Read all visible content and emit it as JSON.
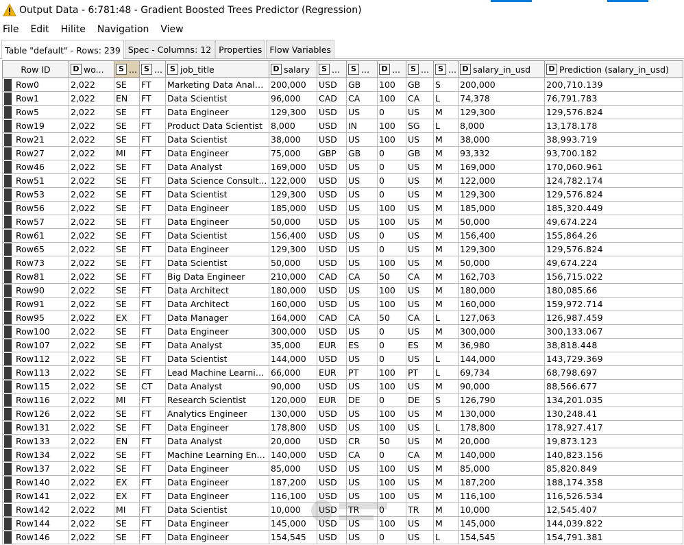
{
  "window": {
    "title": "Output Data - 6:781:48 - Gradient Boosted Trees Predictor (Regression)"
  },
  "menu": [
    "File",
    "Edit",
    "Hilite",
    "Navigation",
    "View"
  ],
  "tabs": [
    "Table \"default\" - Rows: 239",
    "Spec - Columns: 12",
    "Properties",
    "Flow Variables"
  ],
  "columns": [
    {
      "type": "",
      "label": "Row ID"
    },
    {
      "type": "D",
      "label": "wo..."
    },
    {
      "type": "S",
      "label": "..."
    },
    {
      "type": "S",
      "label": "..."
    },
    {
      "type": "S",
      "label": "job_title"
    },
    {
      "type": "D",
      "label": "salary"
    },
    {
      "type": "S",
      "label": "..."
    },
    {
      "type": "S",
      "label": "..."
    },
    {
      "type": "D",
      "label": "..."
    },
    {
      "type": "S",
      "label": "..."
    },
    {
      "type": "S",
      "label": "..."
    },
    {
      "type": "D",
      "label": "salary_in_usd"
    },
    {
      "type": "D",
      "label": "Prediction (salary_in_usd)"
    }
  ],
  "rows": [
    [
      "Row0",
      "2,022",
      "SE",
      "FT",
      "Marketing Data Analyst",
      "200,000",
      "USD",
      "GB",
      "100",
      "GB",
      "S",
      "200,000",
      "200,710.139"
    ],
    [
      "Row1",
      "2,022",
      "EN",
      "FT",
      "Data Scientist",
      "96,000",
      "CAD",
      "CA",
      "100",
      "CA",
      "L",
      "74,378",
      "76,791.783"
    ],
    [
      "Row5",
      "2,022",
      "SE",
      "FT",
      "Data Engineer",
      "129,300",
      "USD",
      "US",
      "0",
      "US",
      "M",
      "129,300",
      "129,576.824"
    ],
    [
      "Row19",
      "2,022",
      "SE",
      "FT",
      "Product Data Scientist",
      "8,000",
      "USD",
      "IN",
      "100",
      "SG",
      "L",
      "8,000",
      "13,178.178"
    ],
    [
      "Row21",
      "2,022",
      "SE",
      "FT",
      "Data Scientist",
      "38,000",
      "USD",
      "US",
      "100",
      "US",
      "M",
      "38,000",
      "38,993.719"
    ],
    [
      "Row27",
      "2,022",
      "MI",
      "FT",
      "Data Engineer",
      "75,000",
      "GBP",
      "GB",
      "0",
      "GB",
      "M",
      "93,332",
      "93,700.182"
    ],
    [
      "Row46",
      "2,022",
      "SE",
      "FT",
      "Data Analyst",
      "169,000",
      "USD",
      "US",
      "0",
      "US",
      "M",
      "169,000",
      "170,060.961"
    ],
    [
      "Row51",
      "2,022",
      "SE",
      "FT",
      "Data Science Consult...",
      "122,000",
      "USD",
      "US",
      "0",
      "US",
      "M",
      "122,000",
      "124,782.174"
    ],
    [
      "Row53",
      "2,022",
      "SE",
      "FT",
      "Data Scientist",
      "129,300",
      "USD",
      "US",
      "0",
      "US",
      "M",
      "129,300",
      "129,576.824"
    ],
    [
      "Row56",
      "2,022",
      "SE",
      "FT",
      "Data Engineer",
      "185,000",
      "USD",
      "US",
      "100",
      "US",
      "M",
      "185,000",
      "185,320.449"
    ],
    [
      "Row57",
      "2,022",
      "SE",
      "FT",
      "Data Engineer",
      "50,000",
      "USD",
      "US",
      "100",
      "US",
      "M",
      "50,000",
      "49,674.224"
    ],
    [
      "Row61",
      "2,022",
      "SE",
      "FT",
      "Data Scientist",
      "156,400",
      "USD",
      "US",
      "0",
      "US",
      "M",
      "156,400",
      "155,864.26"
    ],
    [
      "Row65",
      "2,022",
      "SE",
      "FT",
      "Data Engineer",
      "129,300",
      "USD",
      "US",
      "0",
      "US",
      "M",
      "129,300",
      "129,576.824"
    ],
    [
      "Row73",
      "2,022",
      "SE",
      "FT",
      "Data Scientist",
      "50,000",
      "USD",
      "US",
      "100",
      "US",
      "M",
      "50,000",
      "49,674.224"
    ],
    [
      "Row81",
      "2,022",
      "SE",
      "FT",
      "Big Data Engineer",
      "210,000",
      "CAD",
      "CA",
      "50",
      "CA",
      "M",
      "162,703",
      "156,715.022"
    ],
    [
      "Row90",
      "2,022",
      "SE",
      "FT",
      "Data Architect",
      "180,000",
      "USD",
      "US",
      "100",
      "US",
      "M",
      "180,000",
      "180,085.66"
    ],
    [
      "Row91",
      "2,022",
      "SE",
      "FT",
      "Data Architect",
      "160,000",
      "USD",
      "US",
      "100",
      "US",
      "M",
      "160,000",
      "159,972.714"
    ],
    [
      "Row95",
      "2,022",
      "EX",
      "FT",
      "Data Manager",
      "164,000",
      "CAD",
      "CA",
      "50",
      "CA",
      "L",
      "127,063",
      "126,987.459"
    ],
    [
      "Row100",
      "2,022",
      "SE",
      "FT",
      "Data Engineer",
      "300,000",
      "USD",
      "US",
      "0",
      "US",
      "M",
      "300,000",
      "300,133.067"
    ],
    [
      "Row107",
      "2,022",
      "SE",
      "FT",
      "Data Analyst",
      "35,000",
      "EUR",
      "ES",
      "0",
      "ES",
      "M",
      "36,980",
      "38,818.448"
    ],
    [
      "Row112",
      "2,022",
      "SE",
      "FT",
      "Data Scientist",
      "144,000",
      "USD",
      "US",
      "0",
      "US",
      "L",
      "144,000",
      "143,729.369"
    ],
    [
      "Row113",
      "2,022",
      "SE",
      "FT",
      "Lead Machine Learnin...",
      "66,000",
      "EUR",
      "PT",
      "100",
      "PT",
      "L",
      "69,734",
      "68,798.697"
    ],
    [
      "Row115",
      "2,022",
      "SE",
      "CT",
      "Data Analyst",
      "90,000",
      "USD",
      "US",
      "100",
      "US",
      "M",
      "90,000",
      "88,566.677"
    ],
    [
      "Row116",
      "2,022",
      "MI",
      "FT",
      "Research Scientist",
      "120,000",
      "EUR",
      "DE",
      "0",
      "DE",
      "S",
      "126,790",
      "134,201.035"
    ],
    [
      "Row126",
      "2,022",
      "SE",
      "FT",
      "Analytics Engineer",
      "130,000",
      "USD",
      "US",
      "100",
      "US",
      "M",
      "130,000",
      "130,248.41"
    ],
    [
      "Row131",
      "2,022",
      "SE",
      "FT",
      "Data Engineer",
      "178,800",
      "USD",
      "US",
      "100",
      "US",
      "L",
      "178,800",
      "178,927.417"
    ],
    [
      "Row133",
      "2,022",
      "EN",
      "FT",
      "Data Analyst",
      "20,000",
      "USD",
      "CR",
      "50",
      "US",
      "M",
      "20,000",
      "19,873.123"
    ],
    [
      "Row134",
      "2,022",
      "SE",
      "FT",
      "Machine Learning Eng...",
      "140,000",
      "USD",
      "CA",
      "0",
      "CA",
      "M",
      "140,000",
      "140,823.156"
    ],
    [
      "Row137",
      "2,022",
      "SE",
      "FT",
      "Data Engineer",
      "85,000",
      "USD",
      "US",
      "100",
      "US",
      "M",
      "85,000",
      "85,820.849"
    ],
    [
      "Row140",
      "2,022",
      "EX",
      "FT",
      "Data Engineer",
      "187,200",
      "USD",
      "US",
      "100",
      "US",
      "M",
      "187,200",
      "188,174.358"
    ],
    [
      "Row141",
      "2,022",
      "EX",
      "FT",
      "Data Engineer",
      "116,100",
      "USD",
      "US",
      "100",
      "US",
      "M",
      "116,100",
      "116,526.534"
    ],
    [
      "Row142",
      "2,022",
      "MI",
      "FT",
      "Data Scientist",
      "10,000",
      "USD",
      "TR",
      "0",
      "TR",
      "M",
      "10,000",
      "12,545.407"
    ],
    [
      "Row144",
      "2,022",
      "SE",
      "FT",
      "Data Engineer",
      "145,000",
      "USD",
      "US",
      "100",
      "US",
      "M",
      "145,000",
      "144,039.822"
    ],
    [
      "Row146",
      "2,022",
      "SE",
      "FT",
      "Data Engineer",
      "154,545",
      "USD",
      "US",
      "0",
      "US",
      "L",
      "154,545",
      "154,791.381"
    ]
  ]
}
